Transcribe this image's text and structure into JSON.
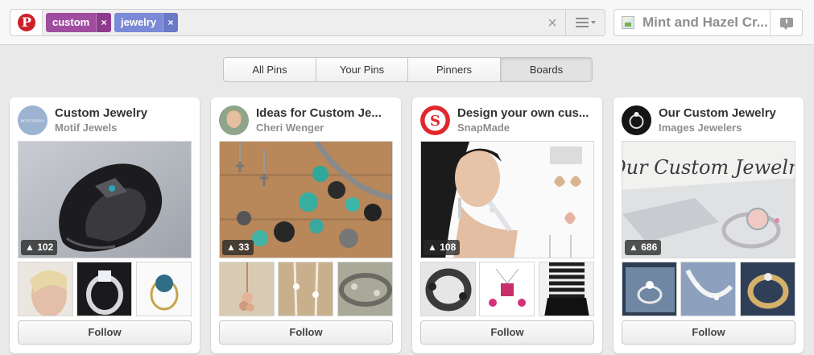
{
  "header": {
    "logo_letter": "P",
    "tokens": [
      {
        "label": "custom",
        "remove": "×"
      },
      {
        "label": "jewelry",
        "remove": "×"
      }
    ],
    "clear": "×",
    "profile_name": "Mint and Hazel Cr..."
  },
  "tabs": [
    {
      "label": "All Pins",
      "active": false
    },
    {
      "label": "Your Pins",
      "active": false
    },
    {
      "label": "Pinners",
      "active": false
    },
    {
      "label": "Boards",
      "active": true
    }
  ],
  "boards": [
    {
      "title": "Custom Jewelry",
      "owner": "Motif Jewels",
      "pin_count": "102",
      "follow": "Follow",
      "avatar_text": "MOTIF JEWELS"
    },
    {
      "title": "Ideas for Custom Je...",
      "owner": "Cheri Wenger",
      "pin_count": "33",
      "follow": "Follow"
    },
    {
      "title": "Design your own cus...",
      "owner": "SnapMade",
      "pin_count": "108",
      "follow": "Follow",
      "avatar_text": "S"
    },
    {
      "title": "Our Custom Jewelry",
      "owner": "Images Jewelers",
      "pin_count": "686",
      "follow": "Follow",
      "cover_text": "Our Custom Jewelry"
    }
  ],
  "colors": {
    "brand_red": "#cb2027",
    "token_custom": "#a04da0",
    "token_jewelry": "#7b8ad6"
  },
  "icons": [
    "pinterest-logo-icon",
    "menu-icon",
    "broken-image-icon",
    "message-icon",
    "pin-icon"
  ]
}
